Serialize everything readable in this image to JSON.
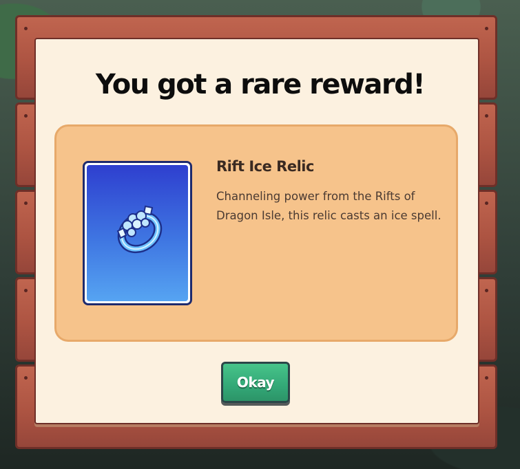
{
  "dialog": {
    "title": "You got a rare reward!"
  },
  "reward": {
    "name": "Rift Ice Relic",
    "description": "Channeling power from the Rifts of Dragon Isle, this relic casts an ice spell.",
    "icon": "ice-ring-icon"
  },
  "actions": {
    "okay_label": "Okay"
  },
  "colors": {
    "board_wood": "#ad5442",
    "paper": "#fcf1e0",
    "card": "#f6c38b",
    "item_frame_top": "#2e3fcf",
    "item_frame_bottom": "#56a4f2",
    "button_green": "#33a877"
  }
}
